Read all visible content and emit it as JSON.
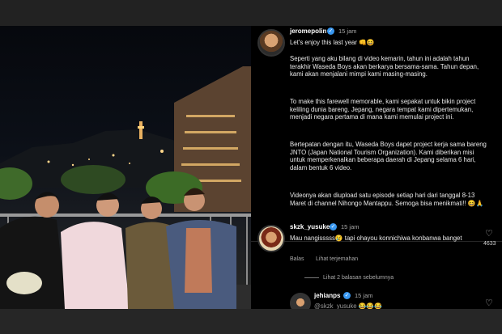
{
  "post": {
    "username": "jeromepolin",
    "time": "15 jam",
    "caption": [
      "Let's enjoy this last year 👊😆",
      "Seperti yang aku bilang di video kemarin, tahun ini adalah tahun terakhir Waseda Boys akan berkarya bersama-sama. Tahun depan, kami akan menjalani mimpi kami masing-masing.",
      "To make this farewell memorable, kami sepakat untuk bikin project keliling dunia bareng. Jepang, negara tempat kami dipertemukan, menjadi negara pertama di mana kami memulai project ini.",
      "Bertepatan dengan itu, Waseda Boys dapet project kerja sama bareng JNTO (Japan National Tourism Organization). Kami diberikan misi untuk memperkenalkan beberapa daerah di Jepang selama 6 hari, dalam bentuk 6 video.",
      "Videonya akan diupload satu episode setiap hari dari tanggal 8-13 Maret di channel Nihongo Mantappu. Semoga bisa menikmati!! 😆🙏"
    ]
  },
  "comments": [
    {
      "username": "skzk_yusuke",
      "time": "15 jam",
      "text": "Mau nangisssss😢 tapi ohayou konnichiwa konbanwa banget",
      "reply_label": "Balas",
      "translate_label": "Lihat terjemahan",
      "likes": "4633",
      "view_replies": "Lihat 2 balasan sebelumnya"
    },
    {
      "username": "jehianps",
      "time": "15 jam",
      "text": "@skzk_yusuke 😂😂😂"
    }
  ],
  "icons": {
    "verified": "verified-badge-icon",
    "like": "heart-icon"
  },
  "colors": {
    "verified": "#3897f0",
    "panel_bg": "#000000",
    "text": "#f2f2f2",
    "muted": "#a8a8a8"
  }
}
